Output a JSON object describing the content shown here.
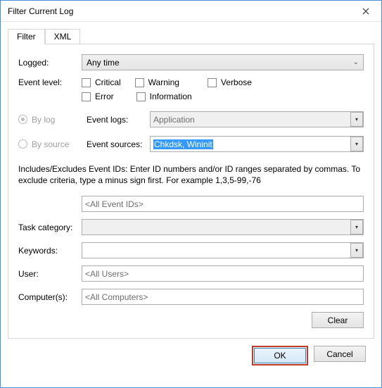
{
  "window": {
    "title": "Filter Current Log"
  },
  "tabs": {
    "filter": "Filter",
    "xml": "XML"
  },
  "labels": {
    "logged": "Logged:",
    "event_level": "Event level:",
    "by_log": "By log",
    "by_source": "By source",
    "event_logs": "Event logs:",
    "event_sources": "Event sources:",
    "task_category": "Task category:",
    "keywords": "Keywords:",
    "user": "User:",
    "computers": "Computer(s):"
  },
  "logged_value": "Any time",
  "levels": {
    "critical": "Critical",
    "warning": "Warning",
    "verbose": "Verbose",
    "error": "Error",
    "information": "Information"
  },
  "event_logs_value": "Application",
  "event_sources_value": "Chkdsk, Wininit",
  "description": "Includes/Excludes Event IDs: Enter ID numbers and/or ID ranges separated by commas. To exclude criteria, type a minus sign first. For example 1,3,5-99,-76",
  "event_ids_placeholder": "<All Event IDs>",
  "user_placeholder": "<All Users>",
  "computers_placeholder": "<All Computers>",
  "buttons": {
    "clear": "Clear",
    "ok": "OK",
    "cancel": "Cancel"
  }
}
